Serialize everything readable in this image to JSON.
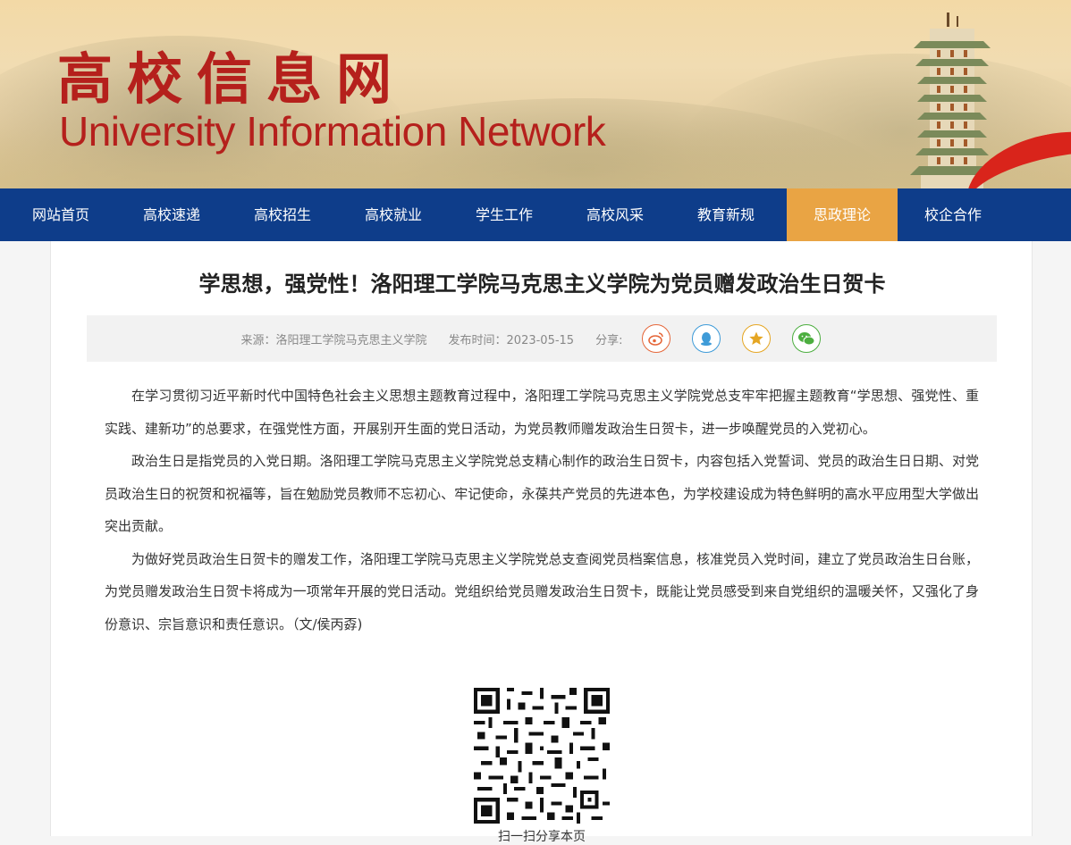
{
  "header": {
    "logo_cn": "高校信息网",
    "logo_en": "University Information Network"
  },
  "nav": {
    "items": [
      {
        "label": "网站首页",
        "active": false
      },
      {
        "label": "高校速递",
        "active": false
      },
      {
        "label": "高校招生",
        "active": false
      },
      {
        "label": "高校就业",
        "active": false
      },
      {
        "label": "学生工作",
        "active": false
      },
      {
        "label": "高校风采",
        "active": false
      },
      {
        "label": "教育新规",
        "active": false
      },
      {
        "label": "思政理论",
        "active": true
      },
      {
        "label": "校企合作",
        "active": false
      }
    ]
  },
  "article": {
    "title": "学思想，强党性！洛阳理工学院马克思主义学院为党员赠发政治生日贺卡",
    "source": "来源：洛阳理工学院马克思主义学院",
    "date_label": "发布时间：",
    "date": "2023-05-15",
    "share_label": "分享:",
    "share_icons": [
      "weibo-icon",
      "qq-icon",
      "qzone-star-icon",
      "wechat-icon"
    ],
    "paragraphs": [
      "在学习贯彻习近平新时代中国特色社会主义思想主题教育过程中，洛阳理工学院马克思主义学院党总支牢牢把握主题教育“学思想、强党性、重实践、建新功”的总要求，在强党性方面，开展别开生面的党日活动，为党员教师赠发政治生日贺卡，进一步唤醒党员的入党初心。",
      "政治生日是指党员的入党日期。洛阳理工学院马克思主义学院党总支精心制作的政治生日贺卡，内容包括入党誓词、党员的政治生日日期、对党员政治生日的祝贺和祝福等，旨在勉励党员教师不忘初心、牢记使命，永葆共产党员的先进本色，为学校建设成为特色鲜明的高水平应用型大学做出突出贡献。",
      "为做好党员政治生日贺卡的赠发工作，洛阳理工学院马克思主义学院党总支查阅党员档案信息，核准党员入党时间，建立了党员政治生日台账，为党员赠发政治生日贺卡将成为一项常年开展的党日活动。党组织给党员赠发政治生日贺卡，既能让党员感受到来自党组织的温暖关怀，又强化了身份意识、宗旨意识和责任意识。（文/侯丙孬)"
    ],
    "qr_caption": "扫一扫分享本页"
  },
  "colors": {
    "nav_bg": "#0e3d8a",
    "nav_active": "#e9a444",
    "logo_red": "#b5201c"
  }
}
